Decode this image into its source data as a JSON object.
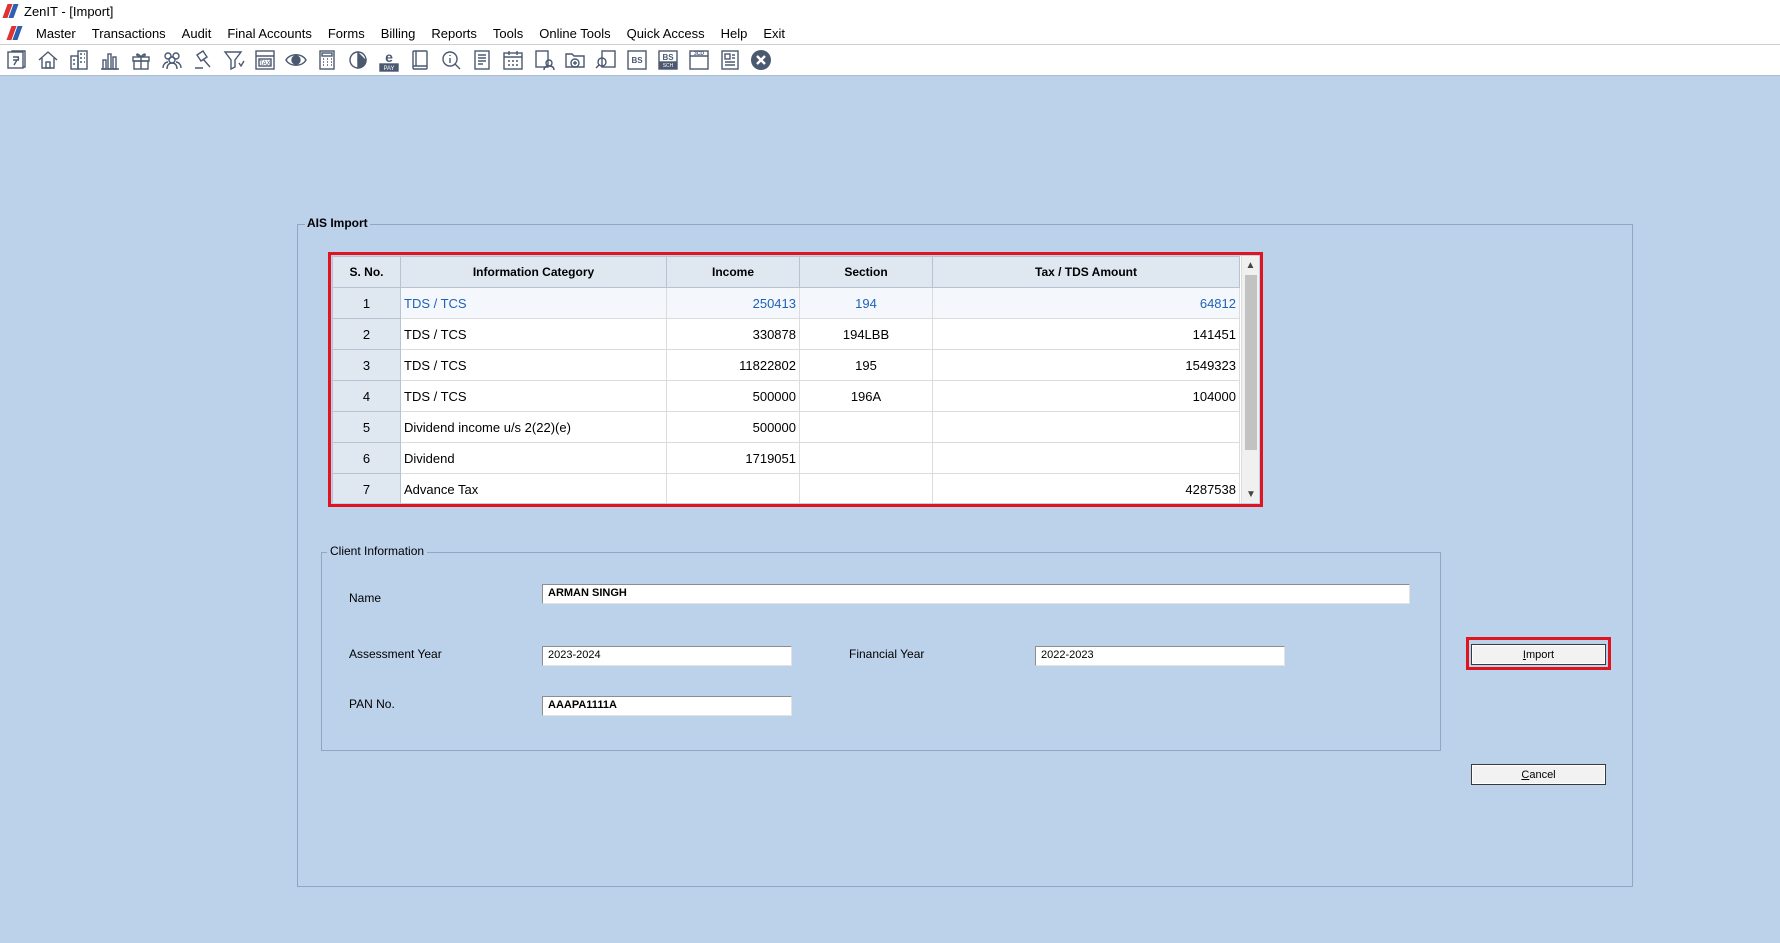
{
  "window": {
    "title": "ZenIT - [Import]"
  },
  "menu": [
    "Master",
    "Transactions",
    "Audit",
    "Final Accounts",
    "Forms",
    "Billing",
    "Reports",
    "Tools",
    "Online Tools",
    "Quick Access",
    "Help",
    "Exit"
  ],
  "toolbar": {
    "icons": [
      "rupee-doc-icon",
      "home-icon",
      "building-icon",
      "bar-chart-icon",
      "gift-icon",
      "users-icon",
      "gavel-icon",
      "filter-icon",
      "tax-icon",
      "eye-icon",
      "calculator-icon",
      "pie-chart-icon",
      "epay-icon",
      "book-icon",
      "info-search-icon",
      "list-doc-icon",
      "calendar-icon",
      "user-doc-icon",
      "folder-add-icon",
      "doc-search-icon",
      "bs-icon",
      "bs-sch-icon",
      "3cd-icon",
      "report-icon",
      "close-circle-icon"
    ],
    "labels": {
      "tax": "TAX",
      "epay": "PAY",
      "bs": "BS",
      "bs_sch": "BS",
      "sch": "SCH",
      "3cd": "3CD"
    }
  },
  "ais": {
    "title": "AIS Import",
    "columns": [
      "S. No.",
      "Information Category",
      "Income",
      "Section",
      "Tax / TDS Amount"
    ],
    "rows": [
      {
        "sno": "1",
        "category": "TDS / TCS",
        "income": "250413",
        "section": "194",
        "amount": "64812"
      },
      {
        "sno": "2",
        "category": "TDS / TCS",
        "income": "330878",
        "section": "194LBB",
        "amount": "141451"
      },
      {
        "sno": "3",
        "category": "TDS / TCS",
        "income": "11822802",
        "section": "195",
        "amount": "1549323"
      },
      {
        "sno": "4",
        "category": "TDS / TCS",
        "income": "500000",
        "section": "196A",
        "amount": "104000"
      },
      {
        "sno": "5",
        "category": "Dividend income u/s 2(22)(e)",
        "income": "500000",
        "section": "",
        "amount": ""
      },
      {
        "sno": "6",
        "category": "Dividend",
        "income": "1719051",
        "section": "",
        "amount": ""
      },
      {
        "sno": "7",
        "category": "Advance Tax",
        "income": "",
        "section": "",
        "amount": "4287538"
      }
    ]
  },
  "client": {
    "title": "Client Information",
    "name_label": "Name",
    "name_value": "ARMAN SINGH",
    "ay_label": "Assessment Year",
    "ay_value": "2023-2024",
    "fy_label": "Financial Year",
    "fy_value": "2022-2023",
    "pan_label": "PAN No.",
    "pan_value": "AAAPA1111A"
  },
  "buttons": {
    "import_u": "I",
    "import_rest": "mport",
    "cancel_u": "C",
    "cancel_rest": "ancel"
  },
  "colors": {
    "background": "#bcd1ea",
    "highlight": "#e0141e",
    "selected_text": "#1f62b9"
  }
}
